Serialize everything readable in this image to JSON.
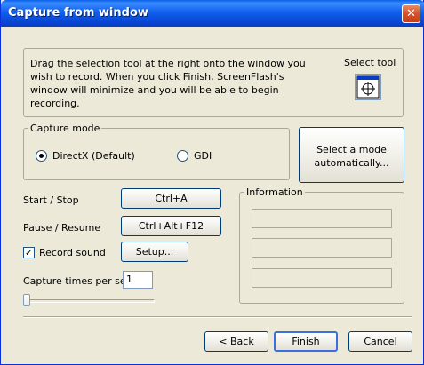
{
  "window": {
    "title": "Capture from window",
    "close_glyph": "✕"
  },
  "instructions": {
    "text": "Drag the selection tool at the right onto the window you wish to record. When you click Finish, ScreenFlash's window will minimize and you will be able to begin recording.",
    "select_tool_label": "Select tool",
    "select_tool_icon": "crosshair-target-icon"
  },
  "capture_mode": {
    "group_label": "Capture mode",
    "options": [
      {
        "label": "DirectX (Default)",
        "selected": true
      },
      {
        "label": "GDI",
        "selected": false
      }
    ],
    "auto_button": "Select a mode automatically..."
  },
  "hotkeys": {
    "start_stop_label": "Start / Stop",
    "start_stop_key": "Ctrl+A",
    "pause_resume_label": "Pause / Resume",
    "pause_resume_key": "Ctrl+Alt+F12"
  },
  "sound": {
    "record_label": "Record sound",
    "record_checked": true,
    "setup_button": "Setup..."
  },
  "capture_rate": {
    "label": "Capture times per sec",
    "value": "1",
    "slider_level": 0
  },
  "information": {
    "group_label": "Information",
    "fields": [
      "",
      "",
      ""
    ]
  },
  "footer": {
    "back_button": "< Back",
    "finish_button": "Finish",
    "cancel_button": "Cancel"
  },
  "colors": {
    "titlebar": "#0a5fe6",
    "dialog_background": "#ece9d8",
    "close_button": "#d2532a"
  }
}
